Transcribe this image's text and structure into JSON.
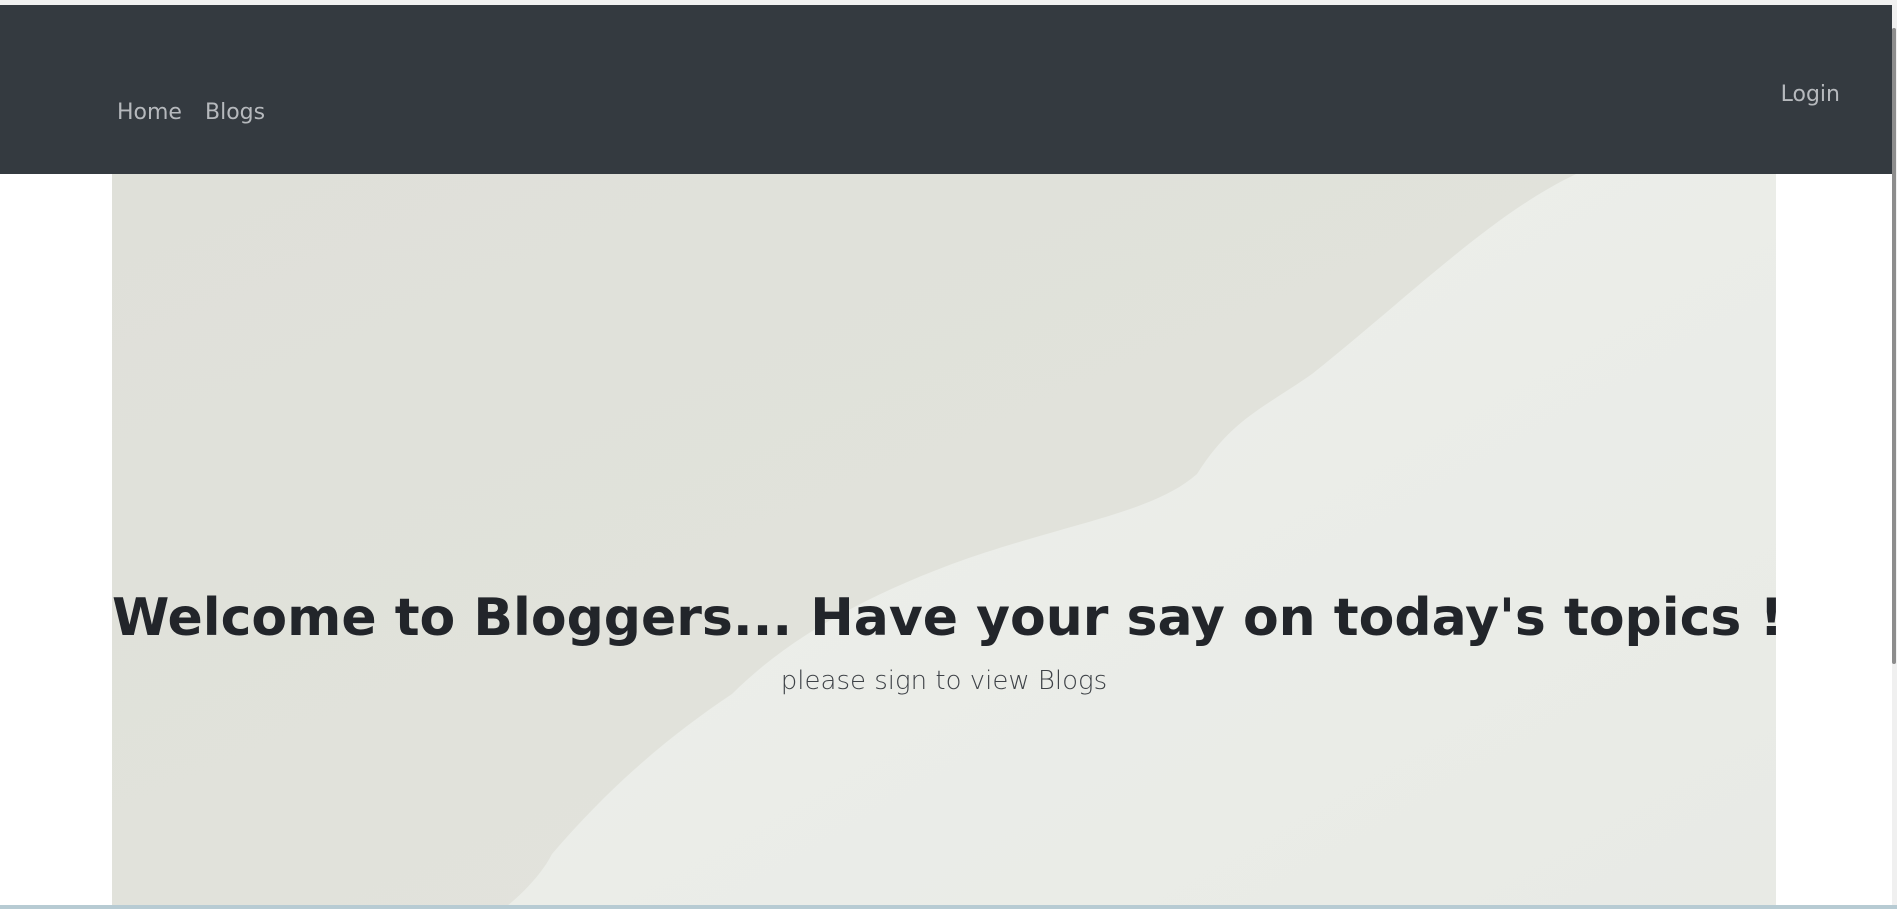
{
  "navbar": {
    "links": [
      "Home",
      "Blogs"
    ],
    "login_label": "Login"
  },
  "hero": {
    "title": "Welcome to Bloggers... Have your say on today's topics !",
    "subtitle": "please sign to view Blogs"
  },
  "colors": {
    "navbar_bg": "#343a40",
    "nav_link": "#b6b9bd",
    "hero_bg": "#e2e3dc",
    "hero_light": "#eceee9",
    "title": "#22252a"
  }
}
